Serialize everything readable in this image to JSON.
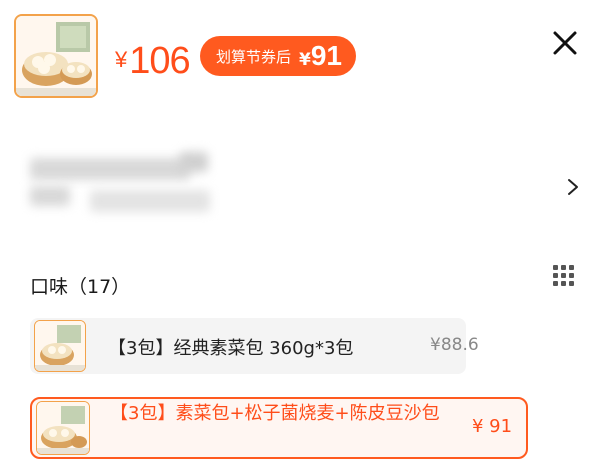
{
  "header": {
    "price_symbol": "¥",
    "price_value": "106",
    "coupon_label": "划算节券后",
    "coupon_symbol": "¥",
    "coupon_value": "91"
  },
  "flavors": {
    "title": "口味（17）",
    "options": [
      {
        "label": "【3包】经典素菜包 360g*3包",
        "price": "¥88.6",
        "selected": false
      },
      {
        "label": "【3包】素菜包+松子菌烧麦+陈皮豆沙包",
        "price": "¥ 91",
        "selected": true
      }
    ]
  },
  "colors": {
    "accent": "#ff5a1f",
    "price": "#ff4d1a",
    "thumb_border": "#f3a24a"
  },
  "icons": {
    "close": "close-icon",
    "chevron": "chevron-right-icon",
    "grid": "grid-view-icon"
  }
}
